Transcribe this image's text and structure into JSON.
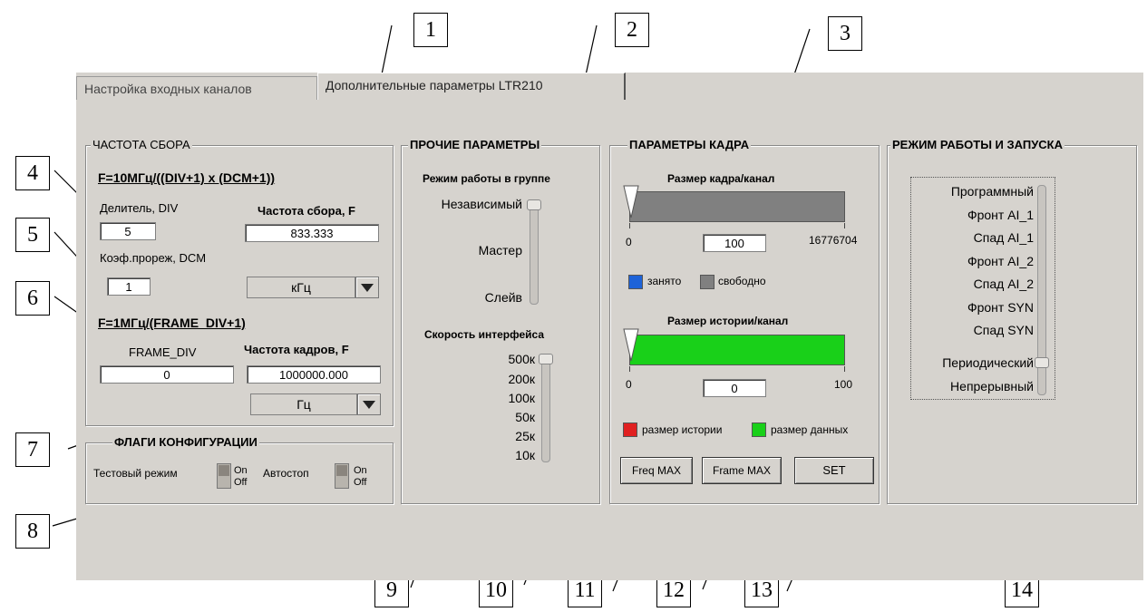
{
  "tabs": [
    {
      "label": "Настройка входных каналов"
    },
    {
      "label": "Дополнительные параметры LTR210"
    }
  ],
  "sampling": {
    "title": "ЧАСТОТА СБОРА",
    "formula": "F=10МГц/((DIV+1) x (DCM+1))",
    "divider_label": "Делитель, DIV",
    "divider_value": "5",
    "freq_label": "Частота сбора, F",
    "freq_value": "833.333",
    "dcm_label": "Коэф.прореж, DCM",
    "dcm_value": "1",
    "freq_unit": "кГц",
    "frame_formula": "F=1МГц/(FRAME_DIV+1)",
    "frame_div_label": "FRAME_DIV",
    "frame_div_value": "0",
    "frame_freq_label": "Частота кадров, F",
    "frame_freq_value": "1000000.000",
    "frame_unit": "Гц"
  },
  "flags": {
    "title": "ФЛАГИ КОНФИГУРАЦИИ",
    "test_mode_label": "Тестовый режим",
    "autostop_label": "Автостоп",
    "on_label": "On",
    "off_label": "Off"
  },
  "other": {
    "title": "ПРОЧИЕ ПАРАМЕТРЫ",
    "group_mode_label": "Режим работы в группе",
    "group_modes": [
      "Независимый",
      "Мастер",
      "Слейв"
    ],
    "iface_speed_label": "Скорость интерфейса",
    "speeds": [
      "500к",
      "200к",
      "100к",
      "50к",
      "25к",
      "10к"
    ]
  },
  "frame": {
    "title": "ПАРАМЕТРЫ КАДРА",
    "size_label": "Размер кадра/канал",
    "size_min": "0",
    "size_max": "16776704",
    "size_value": "100",
    "busy_label": "занято",
    "free_label": "свободно",
    "history_label": "Размер истории/канал",
    "hist_min": "0",
    "hist_max": "100",
    "hist_value": "0",
    "hist_legend": "размер истории",
    "data_legend": "размер данных",
    "freq_max_btn": "Freq MAX",
    "frame_max_btn": "Frame MAX",
    "set_btn": "SET",
    "colors": {
      "busy": "#1e63d8",
      "free": "#808080",
      "history": "#e02020",
      "data": "#19d019"
    }
  },
  "mode": {
    "title": "РЕЖИМ РАБОТЫ И ЗАПУСКА",
    "items": [
      "Программный",
      "Фронт AI_1",
      "Спад AI_1",
      "Фронт AI_2",
      "Спад AI_2",
      "Фронт SYN",
      "Спад SYN",
      "Периодический",
      "Непрерывный"
    ]
  },
  "callouts": [
    "1",
    "2",
    "3",
    "4",
    "5",
    "6",
    "7",
    "8",
    "9",
    "10",
    "11",
    "12",
    "13",
    "14"
  ]
}
